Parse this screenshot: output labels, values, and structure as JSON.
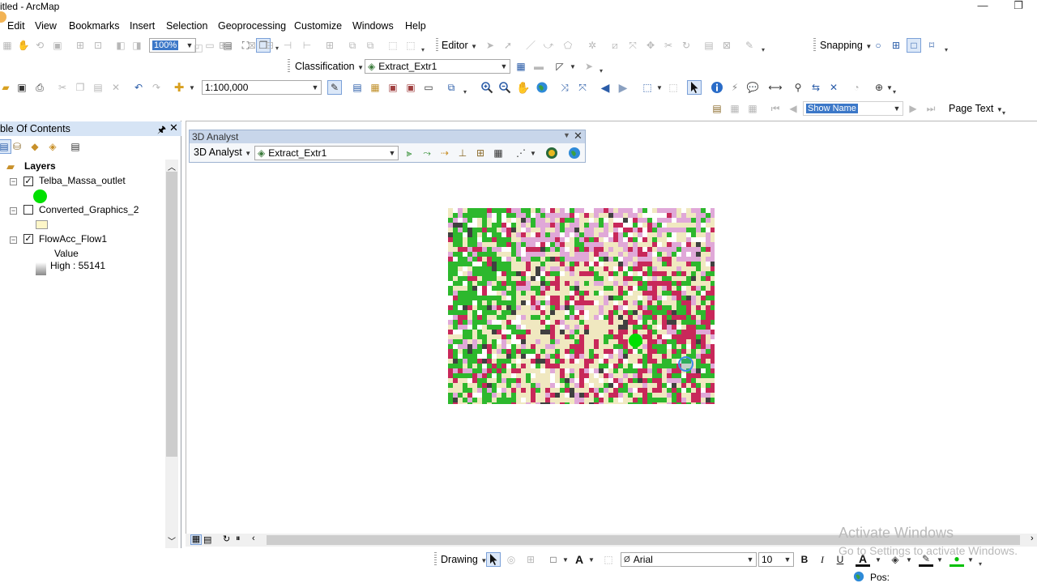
{
  "window": {
    "title": "itled - ArcMap",
    "minimize": "—",
    "restore": "❐"
  },
  "menu": [
    "Edit",
    "View",
    "Bookmarks",
    "Insert",
    "Selection",
    "Geoprocessing",
    "Customize",
    "Windows",
    "Help"
  ],
  "toolbar1": {
    "zoom_value": "100%",
    "editor_label": "Editor",
    "snapping_label": "Snapping"
  },
  "toolbar2": {
    "classification_label": "Classification",
    "layer_combo": "Extract_Extr1"
  },
  "toolbar3": {
    "scale_value": "1:100,000"
  },
  "labels_toolbar": {
    "show_name": "Show Name",
    "page_text": "Page Text"
  },
  "toc": {
    "title": "ble Of Contents",
    "root": "Layers",
    "layers": [
      {
        "name": "Telba_Massa_outlet",
        "checked": true
      },
      {
        "name": "Converted_Graphics_2",
        "checked": false
      },
      {
        "name": "FlowAcc_Flow1",
        "checked": true
      }
    ],
    "legend_value_label": "Value",
    "legend_high_label": "High : 55141"
  },
  "analyst": {
    "title": "3D Analyst",
    "menu_label": "3D Analyst",
    "layer_combo": "Extract_Extr1"
  },
  "drawing": {
    "label": "Drawing",
    "font": "Arial",
    "size": "10",
    "bold": "B",
    "italic": "I",
    "underline": "U"
  },
  "status": {
    "pos_label": "Pos:"
  },
  "watermark": {
    "line1": "Activate Windows",
    "line2": "Go to Settings to activate Windows."
  },
  "colors": {
    "accent": "#3c78c8",
    "toc_header": "#d6e4f5",
    "marker_green": "#00e000",
    "raster_green": "#2db82d",
    "raster_magenta": "#c8285a",
    "raster_pink": "#e0a8d8",
    "raster_cream": "#f0e8c0"
  },
  "icons": [
    "grip",
    "cursor-arrow-icon",
    "identify-icon",
    "zoom-in-icon",
    "zoom-out-icon",
    "pan-icon",
    "globe-icon"
  ]
}
